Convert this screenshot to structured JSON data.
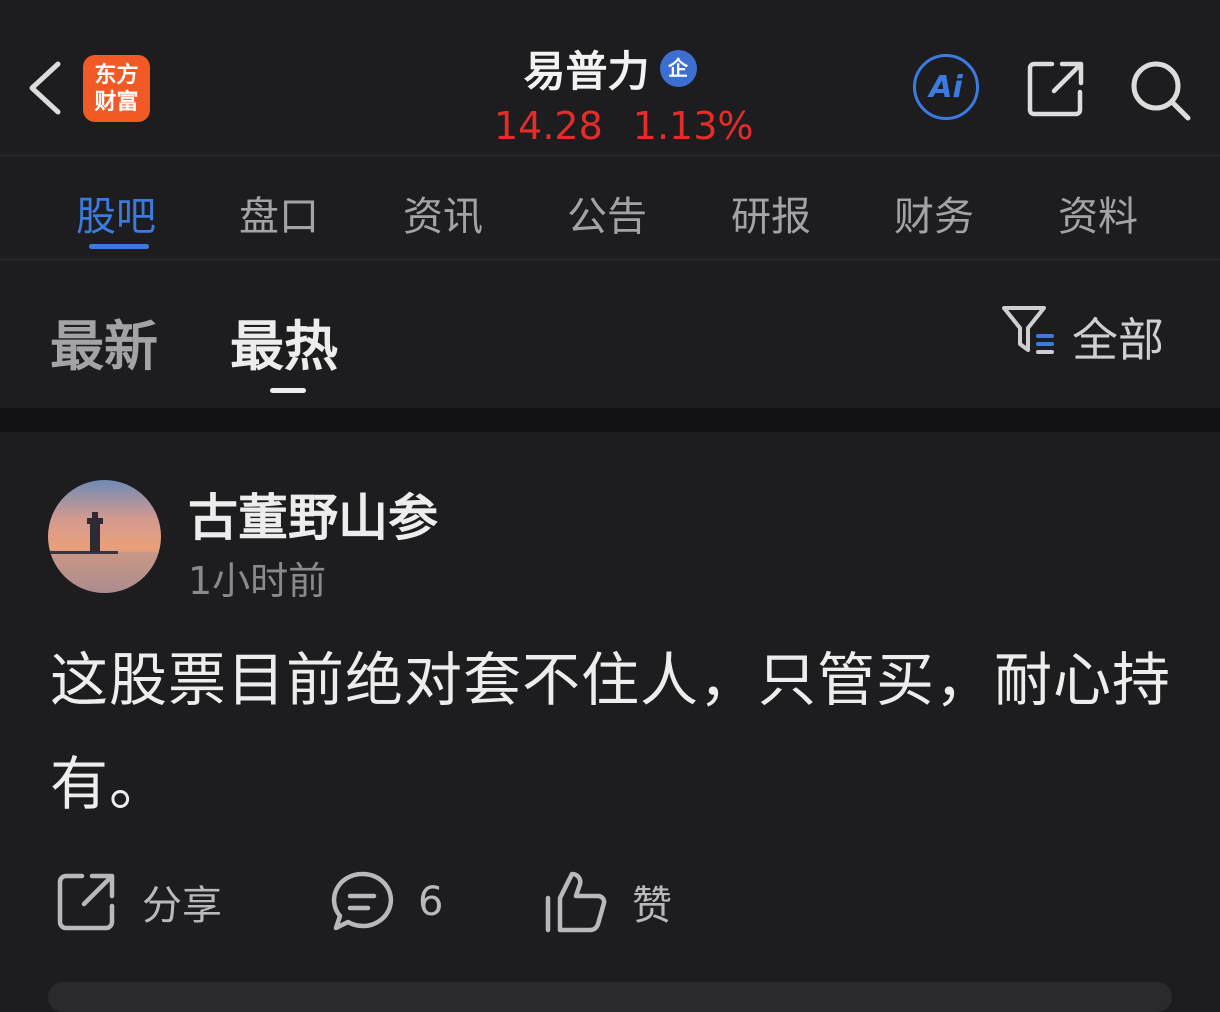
{
  "header": {
    "logo_line1": "东方",
    "logo_line2": "财富",
    "stock_name": "易普力",
    "badge": "企",
    "price": "14.28",
    "change": "1.13%",
    "ai_label": "Ai",
    "icons": [
      "back-icon",
      "ai-icon",
      "share-icon",
      "search-icon"
    ],
    "quote_color": "#e62b2b",
    "accent_color": "#3b7be0"
  },
  "tabs": [
    "股吧",
    "盘口",
    "资讯",
    "公告",
    "研报",
    "财务",
    "资料"
  ],
  "active_tab": "股吧",
  "subtabs": [
    "最新",
    "最热"
  ],
  "active_subtab": "最热",
  "filter": {
    "label": "全部",
    "icon": "filter-icon"
  },
  "post": {
    "author": "古董野山参",
    "time": "1小时前",
    "content": "这股票目前绝对套不住人，只管买，耐心持有。",
    "actions": {
      "share_label": "分享",
      "comment_count": "6",
      "like_label": "赞"
    }
  }
}
